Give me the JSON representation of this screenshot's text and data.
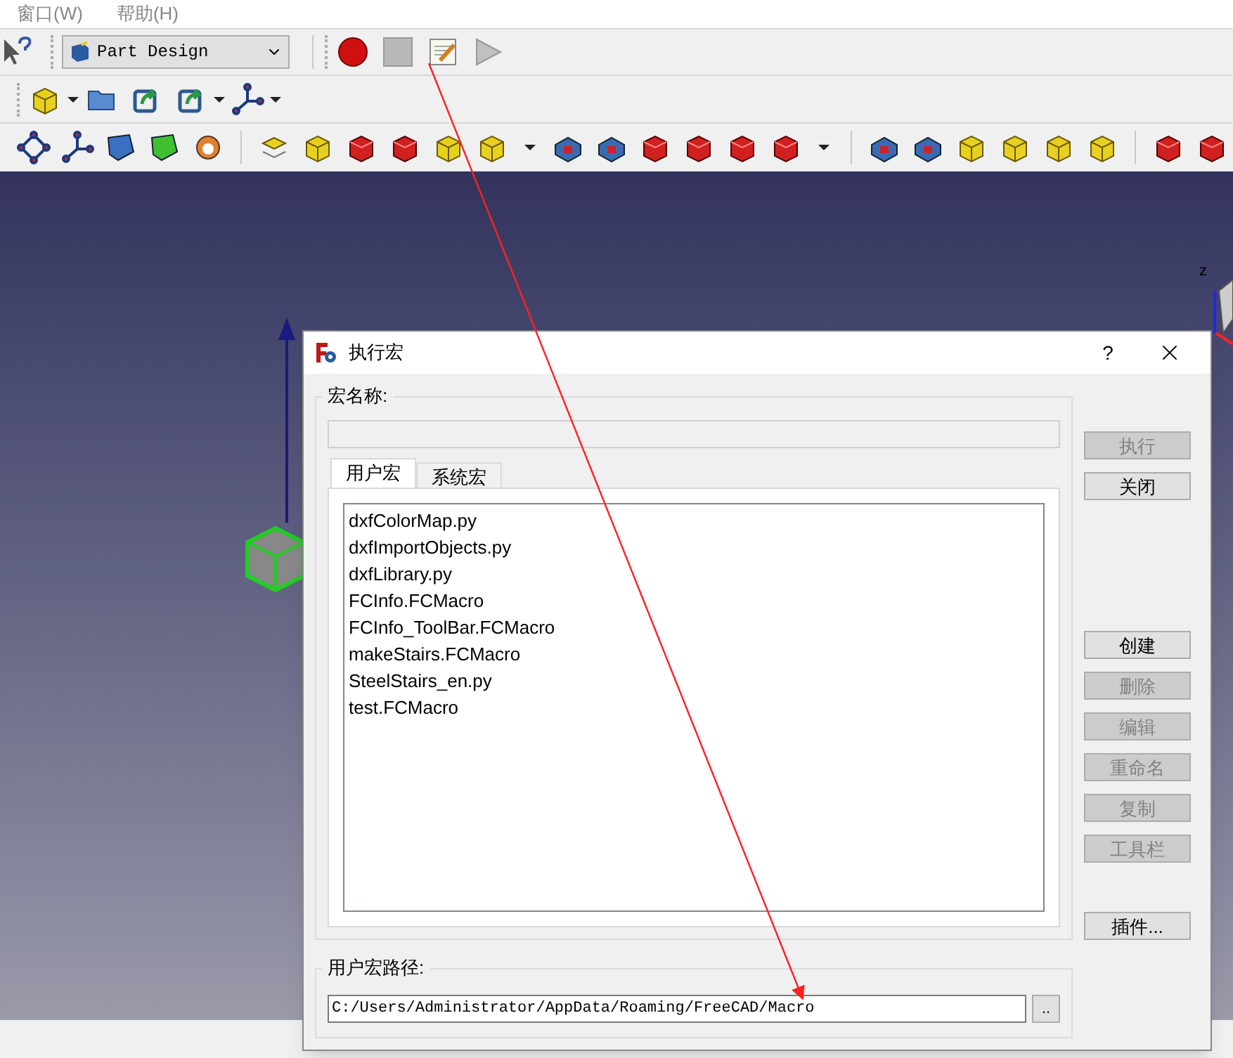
{
  "menu": [
    {
      "label": "窗口(W)"
    },
    {
      "label": "帮助(H)"
    }
  ],
  "workbench": {
    "value": "Part Design"
  },
  "view": {
    "axis_label": "z"
  },
  "dialog": {
    "title": "执行宏",
    "help": "?",
    "name_label": "宏名称:",
    "tabs": [
      {
        "label": "用户宏",
        "selected": true
      },
      {
        "label": "系统宏",
        "selected": false
      }
    ],
    "macros": [
      {
        "name": "dxfColorMap.py",
        "selected": false
      },
      {
        "name": "dxfImportObjects.py",
        "selected": false
      },
      {
        "name": "dxfLibrary.py",
        "selected": false
      },
      {
        "name": "FCInfo.FCMacro",
        "selected": false
      },
      {
        "name": "FCInfo_ToolBar.FCMacro",
        "selected": false
      },
      {
        "name": "makeStairs.FCMacro",
        "selected": false
      },
      {
        "name": "SteelStairs_en.py",
        "selected": false
      },
      {
        "name": "test.FCMacro",
        "selected": false
      }
    ],
    "top_buttons": [
      {
        "label": "执行",
        "disabled": true
      },
      {
        "label": "关闭",
        "disabled": false
      }
    ],
    "manage_buttons": [
      {
        "label": "创建",
        "disabled": false
      },
      {
        "label": "删除",
        "disabled": true
      },
      {
        "label": "编辑",
        "disabled": true
      },
      {
        "label": "重命名",
        "disabled": true
      },
      {
        "label": "复制",
        "disabled": true
      },
      {
        "label": "工具栏",
        "disabled": true
      }
    ],
    "addons_button": {
      "label": "插件...",
      "disabled": false
    },
    "path_label": "用户宏路径:",
    "path_value": "C:/Users/Administrator/AppData/Roaming/FreeCAD/Macro",
    "browse_label": ".."
  }
}
